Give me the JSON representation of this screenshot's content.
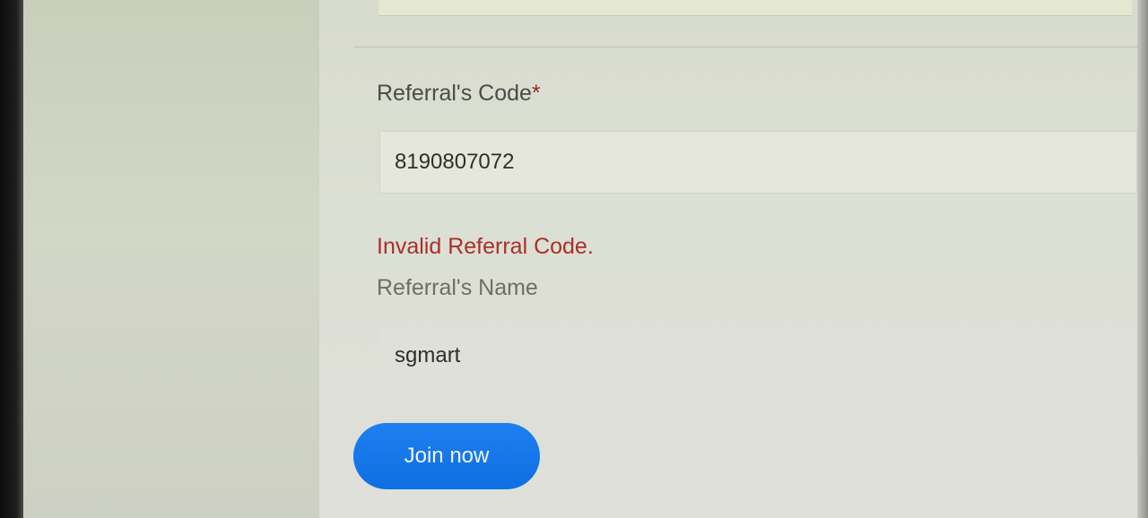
{
  "form": {
    "referral_code": {
      "label": "Referral's Code",
      "required_marker": "*",
      "value": "8190807072"
    },
    "error_message": "Invalid Referral Code.",
    "referral_name": {
      "label": "Referral's Name",
      "value": "sgmart"
    },
    "submit_label": "Join now"
  },
  "colors": {
    "button": "#0e6fe2",
    "error": "#a8312b",
    "required": "#9b2a25"
  }
}
